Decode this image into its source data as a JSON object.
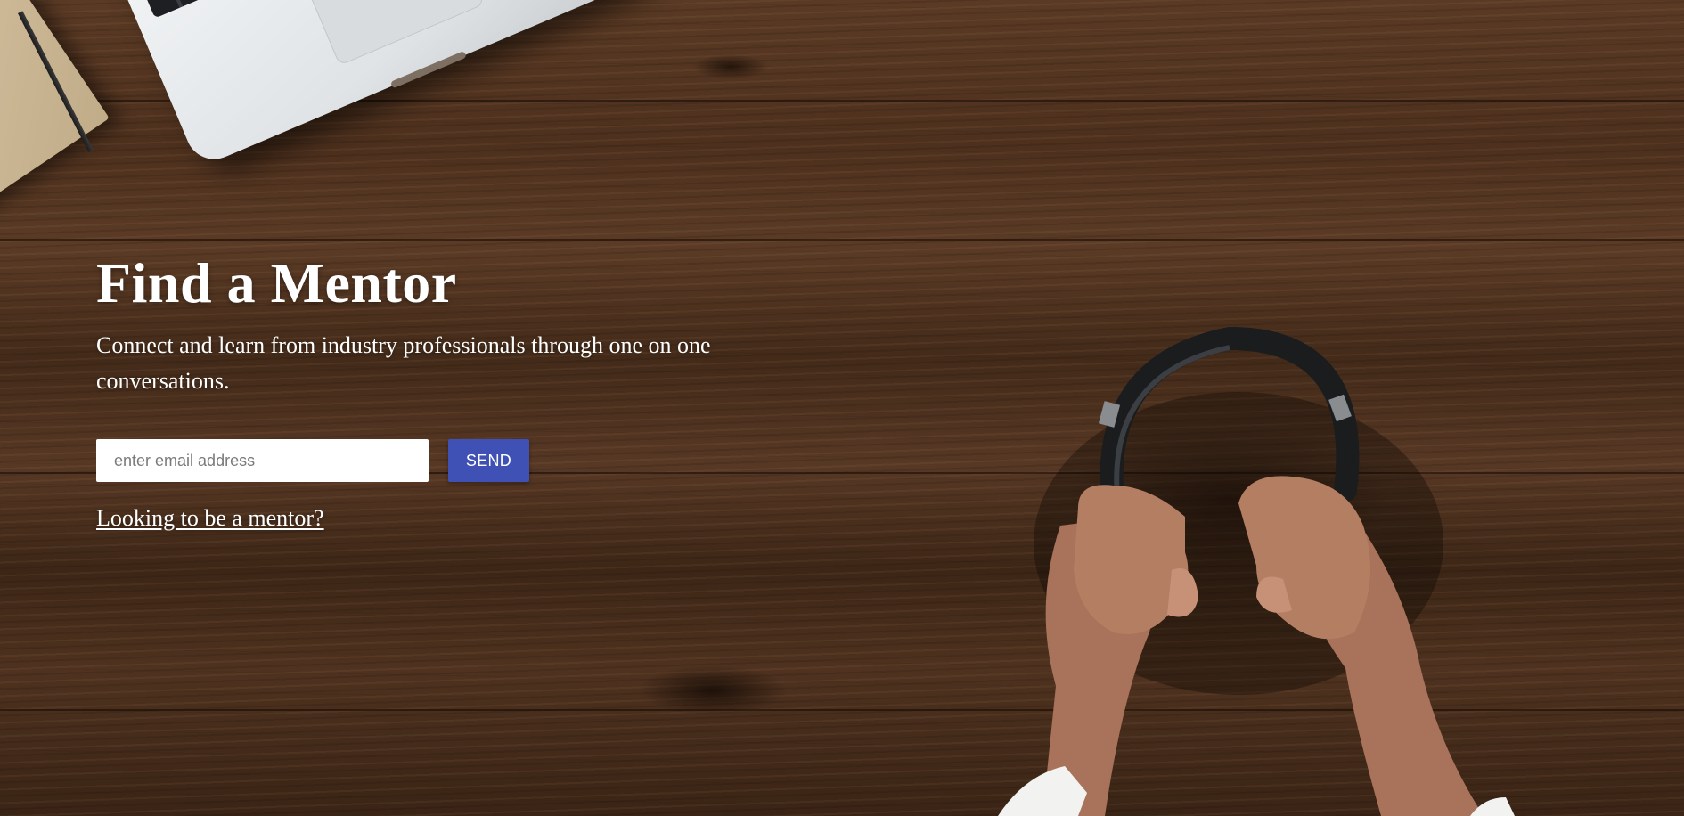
{
  "hero": {
    "title": "Find a Mentor",
    "subtitle": "Connect and learn from industry professionals through one on one conversations.",
    "email_placeholder": "enter email address",
    "send_label": "SEND",
    "mentor_link_label": "Looking to be a mentor?"
  },
  "colors": {
    "send_button": "#3f51b5",
    "text": "#ffffff",
    "wood": "#4a2e1c"
  },
  "background_objects": [
    "laptop",
    "notebook",
    "pencil",
    "headphones",
    "hands"
  ]
}
